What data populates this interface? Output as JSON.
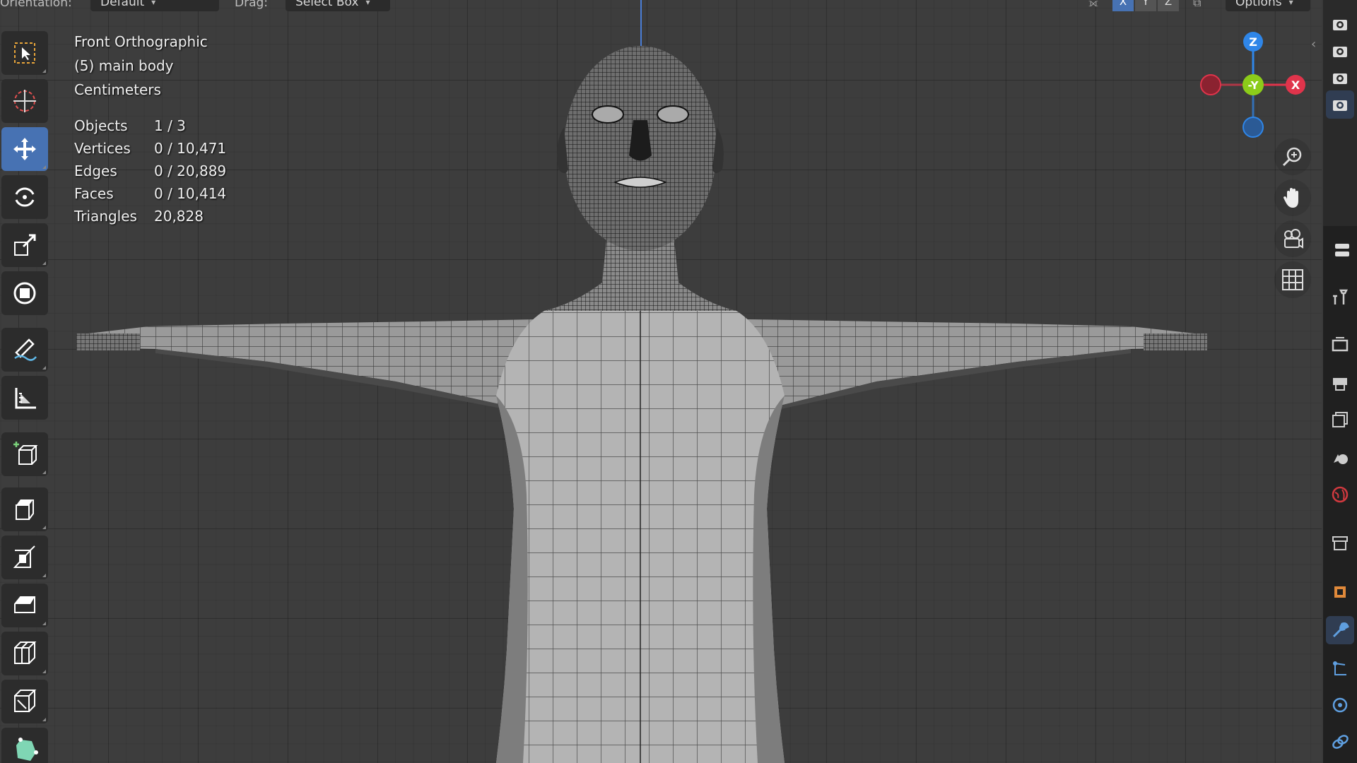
{
  "header": {
    "orientation_label": "Orientation:",
    "orientation_value": "Default",
    "drag_label": "Drag:",
    "drag_value": "Select Box",
    "axis_x": "X",
    "axis_y": "Y",
    "axis_z": "Z",
    "options_label": "Options"
  },
  "overlay": {
    "view_name": "Front Orthographic",
    "collection": "(5) main body",
    "units": "Centimeters",
    "stats": [
      {
        "label": "Objects",
        "value": "1 / 3"
      },
      {
        "label": "Vertices",
        "value": "0 / 10,471"
      },
      {
        "label": "Edges",
        "value": "0 / 20,889"
      },
      {
        "label": "Faces",
        "value": "0 / 10,414"
      },
      {
        "label": "Triangles",
        "value": "20,828"
      }
    ]
  },
  "gizmo": {
    "z_label": "Z",
    "y_label": "-Y",
    "x_label": "X",
    "colors": {
      "x": "#e0344b",
      "y": "#8ccc1a",
      "z": "#2f86e8"
    }
  },
  "toolbar": {
    "active_tool": "move-tool",
    "tools": [
      "select-box-tool",
      "cursor-tool",
      "move-tool",
      "rotate-tool",
      "scale-tool",
      "transform-tool",
      "annotate-tool",
      "measure-tool",
      "add-cube-tool",
      "extrude-region-tool",
      "inset-faces-tool",
      "bevel-tool",
      "loop-cut-tool",
      "knife-tool",
      "poly-build-tool"
    ]
  },
  "colors": {
    "accent": "#4772b3",
    "viewport_bg": "#3d3d3d"
  }
}
